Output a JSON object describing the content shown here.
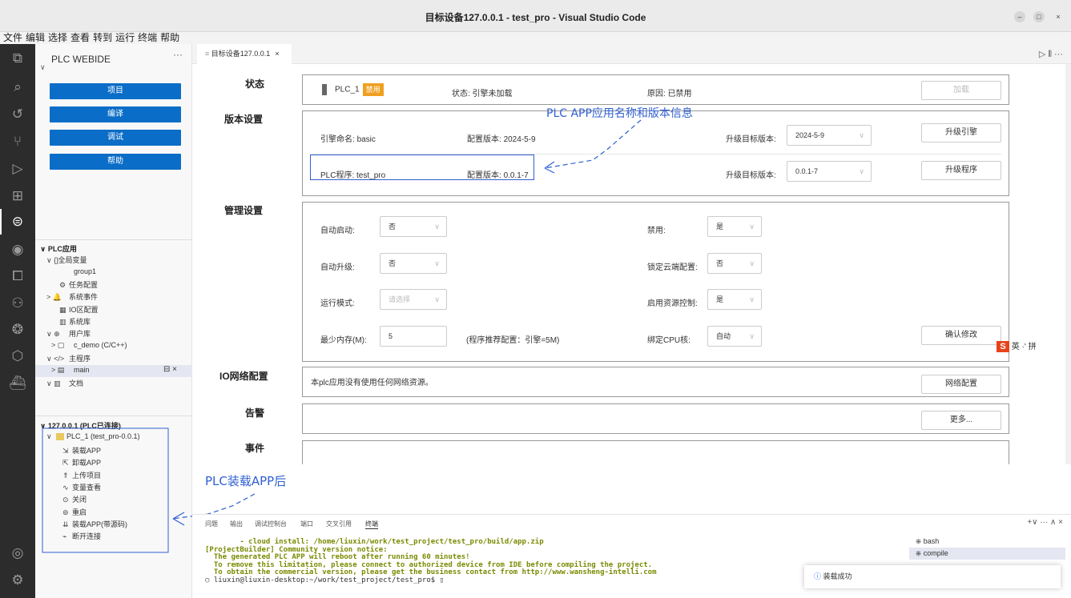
{
  "window": {
    "title": "目标设备127.0.0.1 - test_pro - Visual Studio Code"
  },
  "menu": [
    "文件",
    "编辑",
    "选择",
    "查看",
    "转到",
    "运行",
    "终端",
    "帮助"
  ],
  "sidebar": {
    "title": "PLC WEBIDE",
    "dots": "···",
    "buttons": [
      "项目",
      "编译",
      "调试",
      "帮助"
    ],
    "section1": "PLC应用",
    "tree1": [
      {
        "icon": "∨ {}",
        "label": "全局变量"
      },
      {
        "icon": "",
        "label": "group1"
      },
      {
        "icon": "⚙",
        "label": "任务配置"
      },
      {
        "icon": "> 🔔",
        "label": "系统事件"
      },
      {
        "icon": "▦",
        "label": "IO区配置"
      },
      {
        "icon": "▥",
        "label": "系统库"
      },
      {
        "icon": "∨ ⊕",
        "label": "用户库"
      },
      {
        "icon": "> ▢",
        "label": "c_demo (C/C++)"
      },
      {
        "icon": "∨ </>",
        "label": "主程序"
      },
      {
        "icon": "> ▤",
        "label": "main"
      },
      {
        "icon": "∨ ▥",
        "label": "文档"
      }
    ],
    "section2": "127.0.0.1 (PLC已连接)",
    "plc_node": "PLC_1 (test_pro-0.0.1)",
    "tree2": [
      {
        "icon": "⇲",
        "label": "装载APP"
      },
      {
        "icon": "⇱",
        "label": "卸载APP"
      },
      {
        "icon": "⇑",
        "label": "上传项目"
      },
      {
        "icon": "∿",
        "label": "变量查看"
      },
      {
        "icon": "⊙",
        "label": "关闭"
      },
      {
        "icon": "⊚",
        "label": "重启"
      },
      {
        "icon": "⇊",
        "label": "装载APP(带源码)"
      },
      {
        "icon": "⌁",
        "label": "断开连接"
      }
    ]
  },
  "tab": {
    "label": "目标设备127.0.0.1",
    "close": "×"
  },
  "status": {
    "label": "状态",
    "plc": "PLC_1",
    "badge": "禁用",
    "state": "状态: 引擎未加载",
    "reason": "原因: 已禁用",
    "load_btn": "加载"
  },
  "version": {
    "label": "版本设置",
    "engine_name": "引擎命名:",
    "engine_name_value": "basic",
    "engine_cfg": "配置版本:",
    "engine_cfg_value": "2024-5-9",
    "upgrade_target": "升级目标版本:",
    "engine_select": "2024-5-9",
    "upgrade_engine_btn": "升级引擎",
    "prog_label": "PLC程序:",
    "prog_value": "test_pro",
    "prog_cfg": "配置版本:",
    "prog_cfg_value": "0.0.1-7",
    "prog_target": "升级目标版本:",
    "prog_select": "0.0.1-7",
    "upgrade_prog_btn": "升级程序"
  },
  "manage": {
    "label": "管理设置",
    "autostart": "自动启动:",
    "autostart_val": "否",
    "disable": "禁用:",
    "disable_val": "是",
    "autoupgrade": "自动升级:",
    "autoupgrade_val": "否",
    "lockcloud": "锁定云端配置:",
    "lockcloud_val": "否",
    "runmode": "运行模式:",
    "runmode_ph": "请选择",
    "resctl": "启用资源控制:",
    "resctl_val": "是",
    "minmem": "最少内存(M):",
    "minmem_val": "5",
    "recommend": "(程序推荐配置：引擎=5M)",
    "cpu": "绑定CPU核:",
    "cpu_val": "自动",
    "confirm_btn": "确认修改"
  },
  "io": {
    "label": "IO网络配置",
    "text": "本plc应用没有使用任何网络资源。",
    "btn": "网络配置"
  },
  "alarm": {
    "label": "告警",
    "btn": "更多..."
  },
  "event": {
    "label": "事件"
  },
  "annotations": {
    "top": "PLC APP应用名称和版本信息",
    "left": "PLC装载APP后"
  },
  "ime": {
    "text": "英 ·' 拼"
  },
  "panel": {
    "tabs": [
      "问题",
      "输出",
      "调试控制台",
      "端口",
      "交叉引用",
      "终端"
    ],
    "controls": "+∨ ··· ∧ ×",
    "terminal_lines": [
      "        - cloud install: /home/liuxin/work/test_project/test_pro/build/app.zip",
      "[ProjectBuilder] Community version notice:",
      "  The generated PLC APP will reboot after running 60 minutes!",
      "  To remove this limitation, please connect to authorized device from IDE before compiling the project.",
      "  To obtain the commercial version, please get the business contact from http://www.wansheng-intelli.com",
      "○ liuxin@liuxin-desktop:~/work/test_project/test_pro$ ▯"
    ],
    "terminals": [
      "bash",
      "compile"
    ]
  },
  "notification": {
    "text": "装载成功"
  },
  "colors": {
    "primary_button": "#0a6dc7",
    "badge": "#f0a020",
    "annotation": "#2f5fd0"
  }
}
